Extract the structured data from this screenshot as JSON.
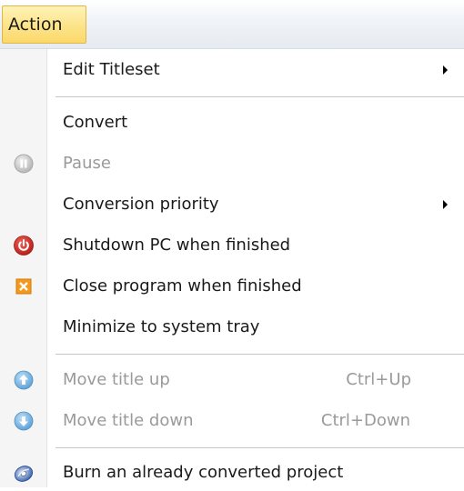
{
  "menubar": {
    "action_label": "Action"
  },
  "menu": {
    "edit_titleset": "Edit Titleset",
    "convert": "Convert",
    "pause": "Pause",
    "conversion_priority": "Conversion priority",
    "shutdown": "Shutdown PC when finished",
    "close_program": "Close program when finished",
    "minimize": "Minimize to system tray",
    "move_up": "Move title up",
    "move_up_shortcut": "Ctrl+Up",
    "move_down": "Move title down",
    "move_down_shortcut": "Ctrl+Down",
    "burn": "Burn an already converted project"
  },
  "icons": {
    "pause": "pause-icon",
    "shutdown": "power-icon",
    "close_program": "close-x-icon",
    "move_up": "arrow-up-icon",
    "move_down": "arrow-down-icon",
    "burn": "disc-burn-icon",
    "submenu": "submenu-arrow-icon"
  },
  "colors": {
    "menu_highlight": "#fde58c",
    "disabled_text": "#9a9a9a",
    "shutdown_red": "#d9322b",
    "close_orange": "#f39a1c",
    "arrow_blue": "#5fa3d8"
  }
}
